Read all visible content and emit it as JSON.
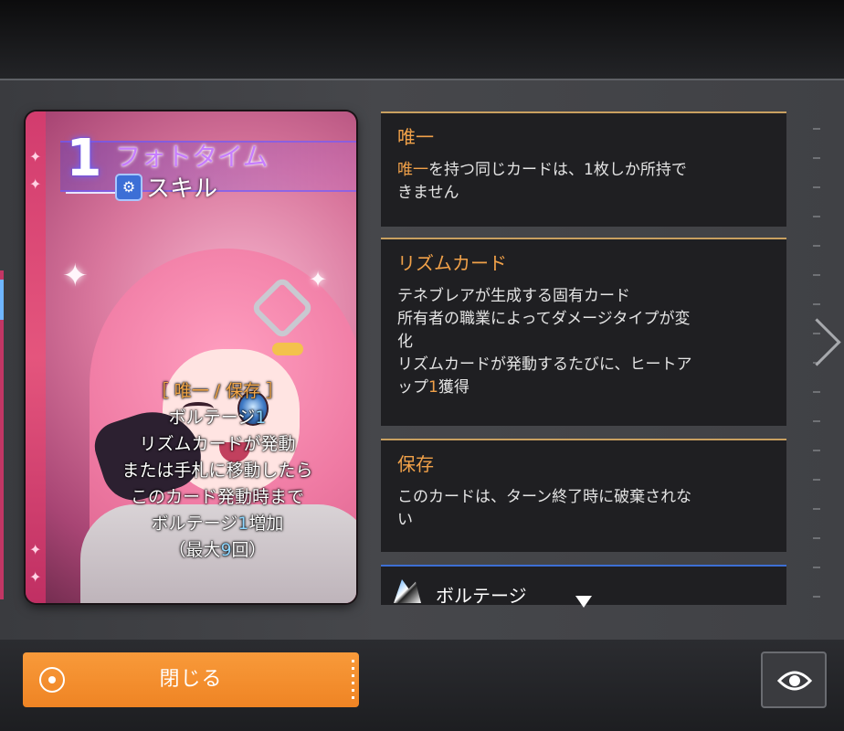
{
  "card": {
    "cost": "1",
    "name": "フォトタイム",
    "type_icon": "skill-icon",
    "type": "スキル",
    "text": {
      "tags": "［ 唯一 / 保存 ］",
      "line1_text": "ボルテージ",
      "line1_num": "1",
      "line2": "リズムカードが発動",
      "line3": "または手札に移動したら",
      "line4": "このカード発動時まで",
      "line5_text_a": "ボルテージ",
      "line5_num": "1",
      "line5_text_b": "増加",
      "line6_a": "（最大",
      "line6_num": "9",
      "line6_b": "回）"
    }
  },
  "panels": [
    {
      "title": "唯一",
      "desc_highlight": "唯一",
      "desc_line1_rest": "を持つ同じカードは、1枚しか所持で",
      "desc_line2": "きません"
    },
    {
      "title": "リズムカード",
      "desc_line1": "テネブレアが生成する固有カード",
      "desc_line2": "所有者の職業によってダメージタイプが変",
      "desc_line3": "化",
      "desc_line4": "リズムカードが発動するたびに、ヒートア",
      "desc_line5_a": "ップ",
      "desc_line5_num": "1",
      "desc_line5_b": "獲得"
    },
    {
      "title": "保存",
      "desc_line1": "このカードは、ターン終了時に破棄されな",
      "desc_line2": "い"
    },
    {
      "icon": "voltage-icon",
      "title": "ボルテージ"
    }
  ],
  "buttons": {
    "close_label": "閉じる",
    "close_icon": "target-icon",
    "eye_icon": "eye-icon",
    "next_icon": "chevron-right-icon",
    "scroll_icon": "caret-down-icon"
  },
  "colors": {
    "accent_orange": "#f1a149",
    "button_orange": "#f48e2e",
    "voltage_blue": "#3d6fd4",
    "card_name_purple": "#c77dff"
  }
}
